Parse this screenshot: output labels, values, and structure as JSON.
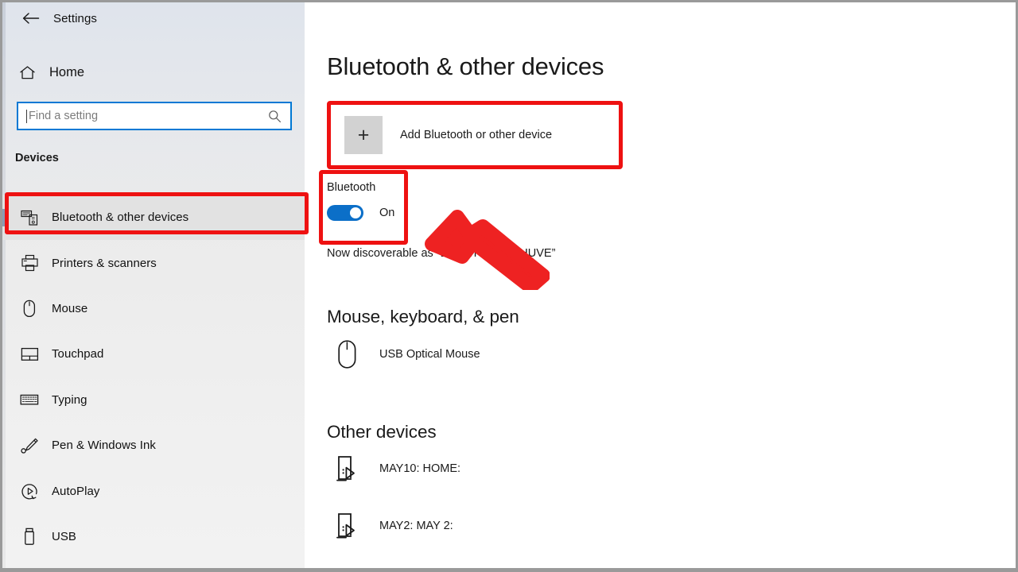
{
  "window": {
    "title": "Settings",
    "back_icon": "back-arrow-icon"
  },
  "sidebar": {
    "home": {
      "label": "Home",
      "icon": "home-icon"
    },
    "search": {
      "placeholder": "Find a setting",
      "value": "",
      "icon": "search-icon"
    },
    "section_label": "Devices",
    "items": [
      {
        "label": "Bluetooth & other devices",
        "icon": "bluetooth-devices-icon",
        "selected": true
      },
      {
        "label": "Printers & scanners",
        "icon": "printer-icon",
        "selected": false
      },
      {
        "label": "Mouse",
        "icon": "mouse-icon",
        "selected": false
      },
      {
        "label": "Touchpad",
        "icon": "touchpad-icon",
        "selected": false
      },
      {
        "label": "Typing",
        "icon": "keyboard-icon",
        "selected": false
      },
      {
        "label": "Pen & Windows Ink",
        "icon": "pen-icon",
        "selected": false
      },
      {
        "label": "AutoPlay",
        "icon": "autoplay-icon",
        "selected": false
      },
      {
        "label": "USB",
        "icon": "usb-icon",
        "selected": false
      }
    ]
  },
  "main": {
    "page_title": "Bluetooth & other devices",
    "add_device": {
      "label": "Add Bluetooth or other device",
      "icon": "plus-icon",
      "plus_glyph": "+"
    },
    "bluetooth": {
      "title": "Bluetooth",
      "toggle_state": "On",
      "toggle_on": true,
      "discoverable_text": "Now discoverable as “DESKTOP-93BHUVE”"
    },
    "groups": [
      {
        "heading": "Mouse, keyboard, & pen",
        "devices": [
          {
            "name": "USB Optical Mouse",
            "icon": "mouse-device-icon"
          }
        ]
      },
      {
        "heading": "Other devices",
        "devices": [
          {
            "name": "MAY10: HOME:",
            "icon": "cast-device-icon"
          },
          {
            "name": "MAY2: MAY 2:",
            "icon": "cast-device-icon"
          }
        ]
      }
    ]
  },
  "annotations": {
    "highlight_color": "#ee1111",
    "arrow_color": "#ee2222",
    "accent_color": "#0078d4",
    "boxes": [
      {
        "name": "sidebar-bluetooth-item"
      },
      {
        "name": "add-device-panel"
      },
      {
        "name": "bluetooth-toggle"
      }
    ],
    "arrow": {
      "name": "pointer-arrow",
      "points_to": "bluetooth-toggle"
    }
  }
}
